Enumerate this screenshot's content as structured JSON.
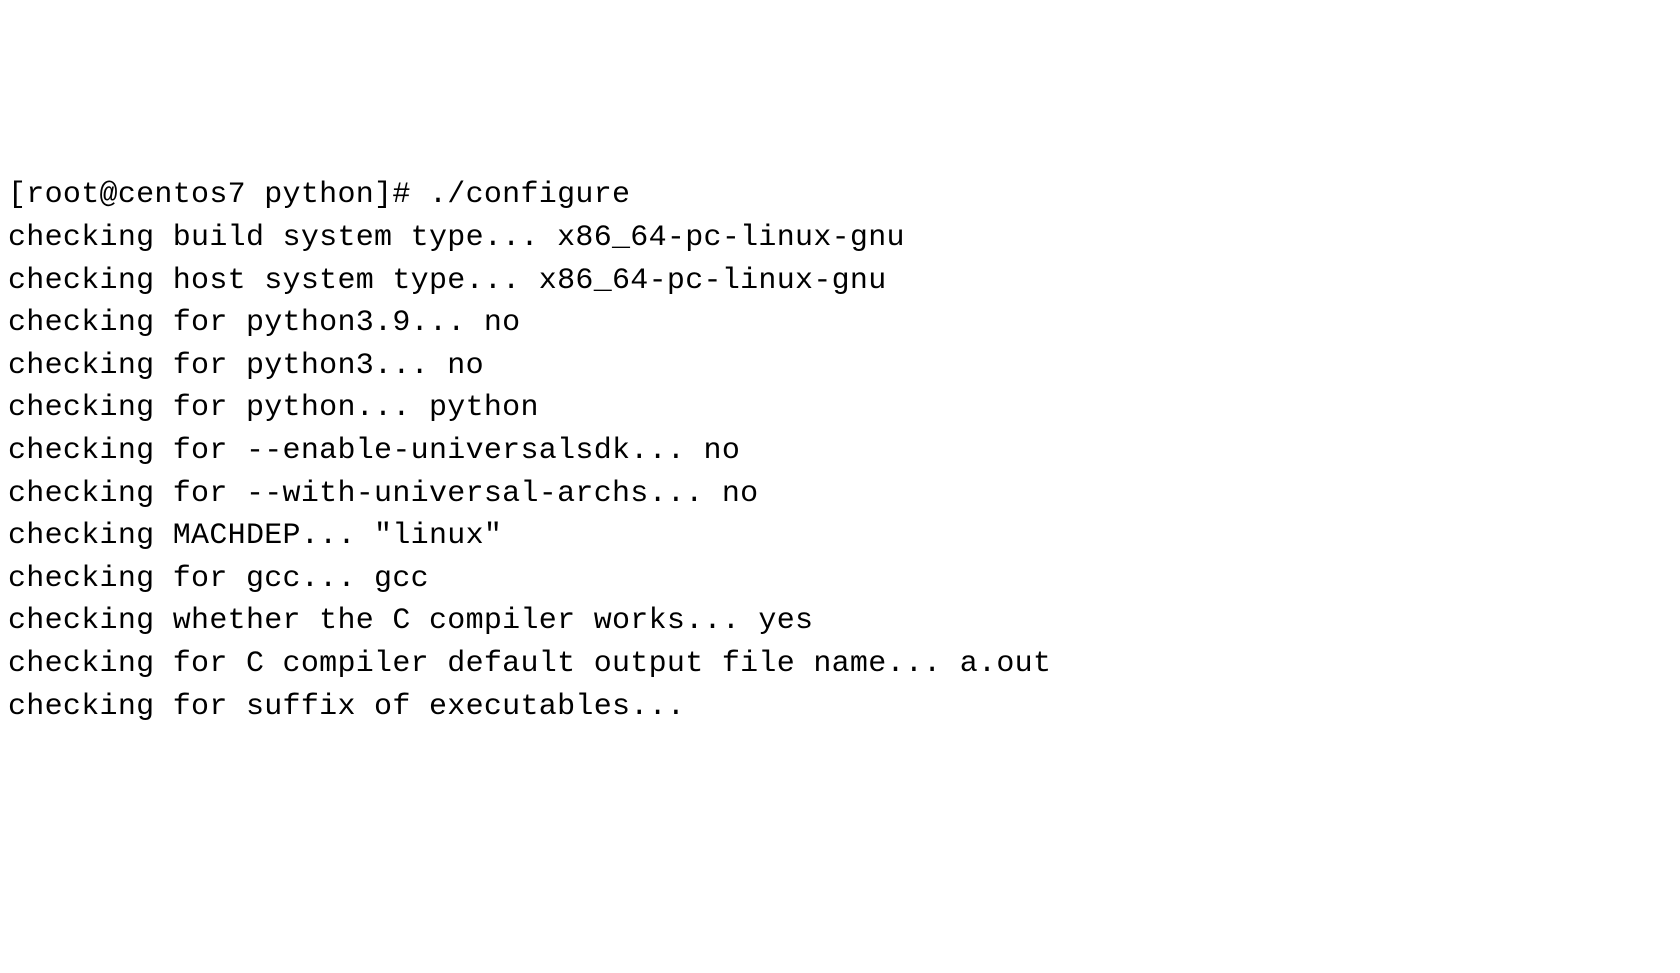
{
  "terminal": {
    "prompt": "[root@centos7 python]# ",
    "command": "./configure",
    "lines": [
      "checking build system type... x86_64-pc-linux-gnu",
      "checking host system type... x86_64-pc-linux-gnu",
      "checking for python3.9... no",
      "checking for python3... no",
      "checking for python... python",
      "checking for --enable-universalsdk... no",
      "checking for --with-universal-archs... no",
      "checking MACHDEP... \"linux\"",
      "checking for gcc... gcc",
      "checking whether the C compiler works... yes",
      "checking for C compiler default output file name... a.out",
      "checking for suffix of executables..."
    ]
  }
}
